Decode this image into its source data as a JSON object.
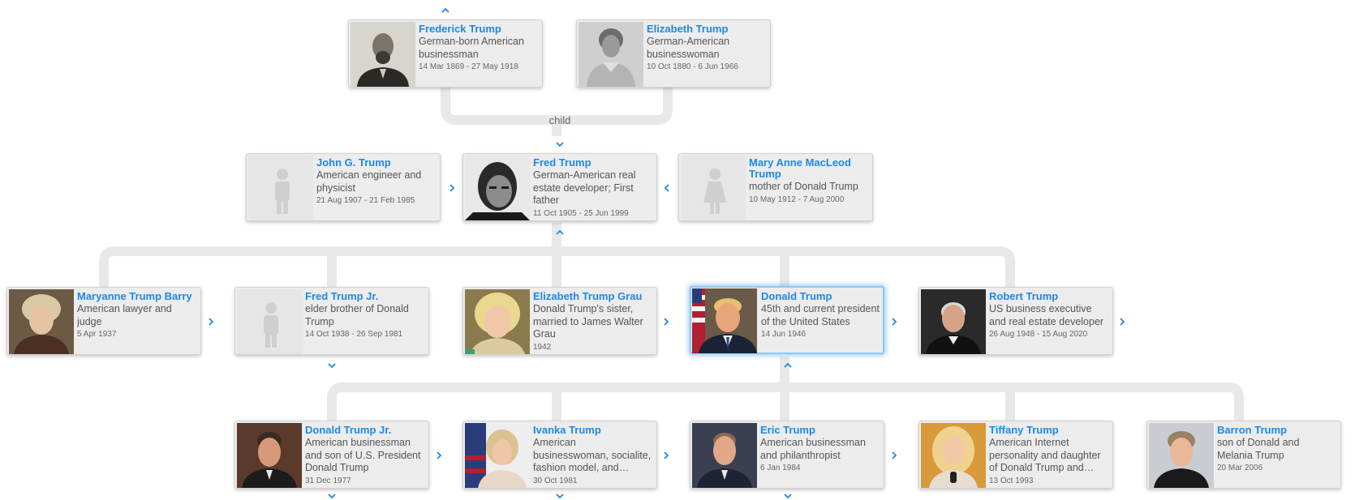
{
  "relation_label": "child",
  "people": {
    "frederick": {
      "name": "Frederick Trump",
      "description": "German-born American businessman",
      "dates": "14 Mar 1869 - 27 May 1918",
      "photo": "portrait-photo"
    },
    "elizabeth": {
      "name": "Elizabeth Trump",
      "description": "German-American businesswoman",
      "dates": "10 Oct 1880 - 6 Jun 1966",
      "photo": "portrait-photo"
    },
    "john": {
      "name": "John G. Trump",
      "description": "American engineer and physicist",
      "dates": "21 Aug 1907 - 21 Feb 1985",
      "photo": "male-placeholder-icon"
    },
    "fred": {
      "name": "Fred Trump",
      "description": "German-American real estate developer; First father",
      "dates": "11 Oct 1905 - 25 Jun 1999",
      "photo": "portrait-photo"
    },
    "mary": {
      "name": "Mary Anne MacLeod Trump",
      "description": "mother of Donald Trump",
      "dates": "10 May 1912 - 7 Aug 2000",
      "photo": "female-placeholder-icon"
    },
    "maryanne": {
      "name": "Maryanne Trump Barry",
      "description": "American lawyer and judge",
      "dates": "5 Apr 1937",
      "photo": "portrait-photo"
    },
    "fredjr": {
      "name": "Fred Trump Jr.",
      "description": "elder brother of Donald Trump",
      "dates": "14 Oct 1938 - 26 Sep 1981",
      "photo": "male-placeholder-icon"
    },
    "elizabethg": {
      "name": "Elizabeth Trump Grau",
      "description": "Donald Trump's sister, married to James Walter Grau",
      "dates": "1942",
      "photo": "portrait-photo"
    },
    "donald": {
      "name": "Donald Trump",
      "description": "45th and current president of the United States",
      "dates": "14 Jun 1946",
      "photo": "portrait-photo"
    },
    "robert": {
      "name": "Robert Trump",
      "description": "US business executive and real estate developer",
      "dates": "26 Aug 1948 - 15 Aug 2020",
      "photo": "portrait-photo"
    },
    "donaldjr": {
      "name": "Donald Trump Jr.",
      "description": "American businessman and son of U.S. President Donald Trump",
      "dates": "31 Dec 1977",
      "photo": "portrait-photo"
    },
    "ivanka": {
      "name": "Ivanka Trump",
      "description": "American businesswoman, socialite, fashion model, and daughter of Donald Trump",
      "dates": "30 Oct 1981",
      "photo": "portrait-photo"
    },
    "eric": {
      "name": "Eric Trump",
      "description": "American businessman and philanthropist",
      "dates": "6 Jan 1984",
      "photo": "portrait-photo"
    },
    "tiffany": {
      "name": "Tiffany Trump",
      "description": "American Internet personality and daughter of Donald Trump and Marla Maples",
      "dates": "13 Oct 1993",
      "photo": "portrait-photo"
    },
    "barron": {
      "name": "Barron Trump",
      "description": "son of Donald and Melania Trump",
      "dates": "20 Mar 2006",
      "photo": "portrait-photo"
    }
  },
  "selected_person": "donald",
  "colors": {
    "accent": "#1e88e5",
    "connector": "#e8e8e8",
    "card_bg": "#ececec",
    "selected_glow": "#8ec9f2"
  }
}
